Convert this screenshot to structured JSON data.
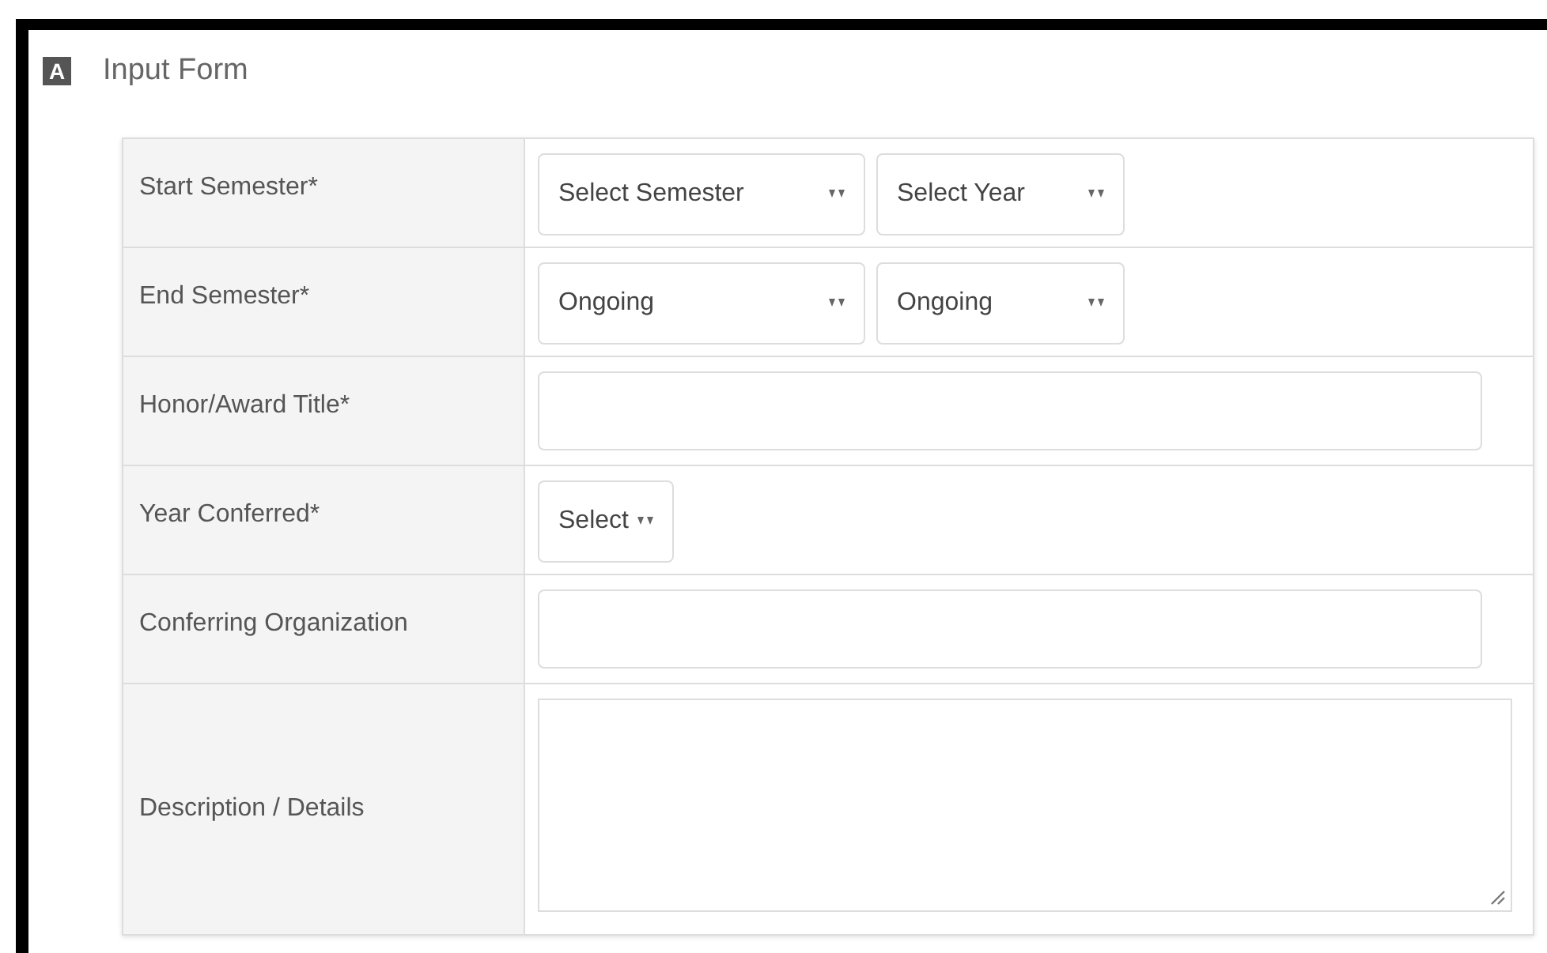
{
  "header": {
    "badge": "A",
    "title": "Input Form"
  },
  "rows": [
    {
      "label": "Start Semester*",
      "controls": [
        {
          "kind": "select",
          "value": "Select Semester"
        },
        {
          "kind": "select",
          "value": "Select Year"
        }
      ]
    },
    {
      "label": "End Semester*",
      "controls": [
        {
          "kind": "select",
          "value": "Ongoing"
        },
        {
          "kind": "select",
          "value": "Ongoing"
        }
      ]
    },
    {
      "label": "Honor/Award Title*",
      "controls": [
        {
          "kind": "text"
        }
      ]
    },
    {
      "label": "Year Conferred*",
      "controls": [
        {
          "kind": "select",
          "value": "Select"
        }
      ]
    },
    {
      "label": "Conferring Organization",
      "controls": [
        {
          "kind": "text"
        }
      ]
    },
    {
      "label": "Description / Details",
      "controls": [
        {
          "kind": "textarea"
        }
      ]
    }
  ]
}
